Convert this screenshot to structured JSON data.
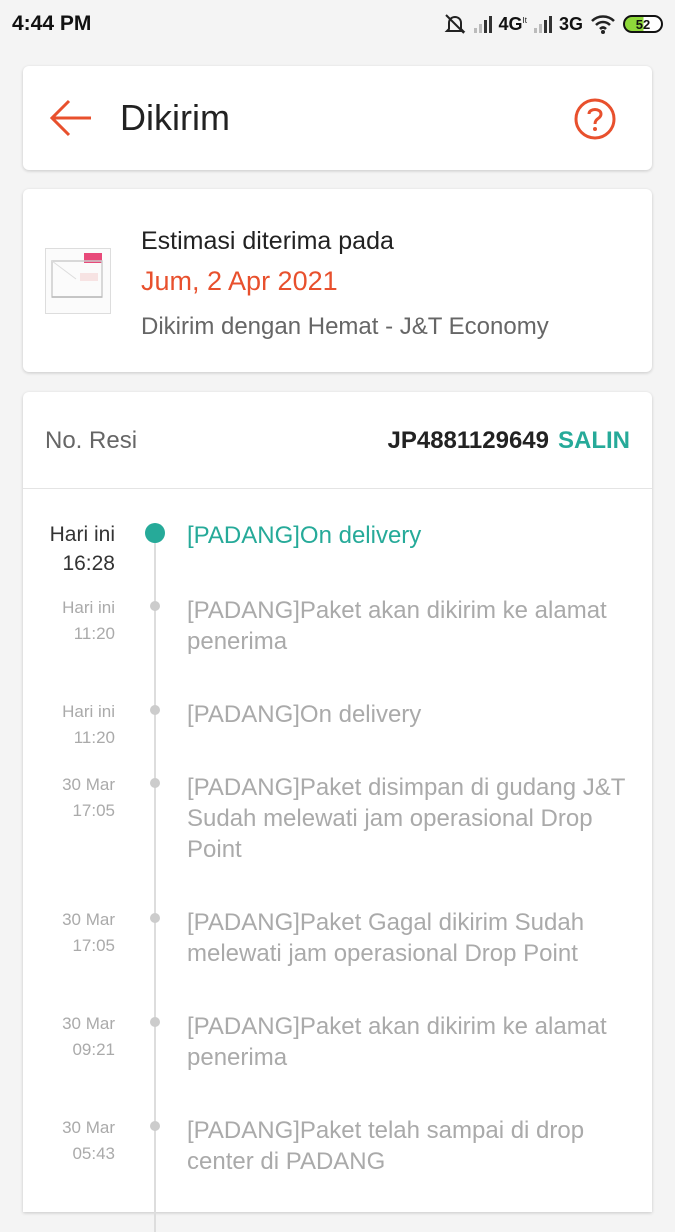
{
  "status_bar": {
    "time": "4:44 PM",
    "network_1": "4G",
    "network_1_sub": "It",
    "network_2": "3G",
    "battery": "52"
  },
  "header": {
    "title": "Dikirim",
    "back_icon": "arrow-left-icon",
    "help_icon": "question-circle-icon"
  },
  "estimate": {
    "title": "Estimasi diterima pada",
    "date": "Jum, 2 Apr 2021",
    "shipper": "Dikirim dengan Hemat - J&T Economy"
  },
  "tracking": {
    "resi_label": "No. Resi",
    "resi_number": "JP4881129649",
    "copy_label": "SALIN",
    "events": [
      {
        "day": "Hari ini",
        "time": "16:28",
        "text": "[PADANG]On delivery",
        "active": true
      },
      {
        "day": "Hari ini",
        "time": "11:20",
        "text": "[PADANG]Paket akan dikirim ke alamat penerima",
        "active": false
      },
      {
        "day": "Hari ini",
        "time": "11:20",
        "text": "[PADANG]On delivery",
        "active": false
      },
      {
        "day": "30 Mar",
        "time": "17:05",
        "text": "[PADANG]Paket disimpan di gudang J&T Sudah melewati jam operasional Drop Point",
        "active": false
      },
      {
        "day": "30 Mar",
        "time": "17:05",
        "text": "[PADANG]Paket Gagal dikirim Sudah melewati jam operasional Drop Point",
        "active": false
      },
      {
        "day": "30 Mar",
        "time": "09:21",
        "text": "[PADANG]Paket akan dikirim ke alamat penerima",
        "active": false
      },
      {
        "day": "30 Mar",
        "time": "05:43",
        "text": "[PADANG]Paket telah sampai di drop center di PADANG",
        "active": false
      }
    ]
  },
  "colors": {
    "accent_orange": "#e8502d",
    "accent_teal": "#26aa99"
  }
}
